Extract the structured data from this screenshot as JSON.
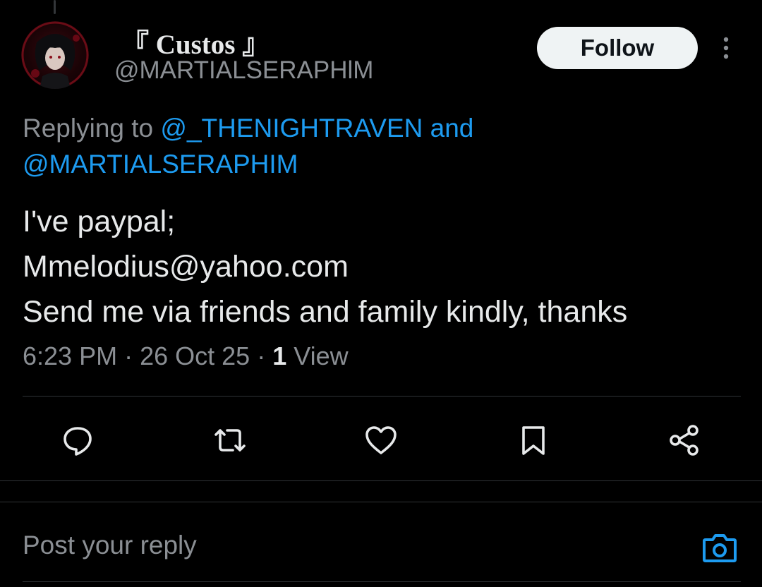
{
  "tweet": {
    "author": {
      "display_name": "『 Custos 』",
      "handle": "@MARTIALSERAPHlM",
      "avatar_icon": "avatar-red-portrait"
    },
    "follow_label": "Follow",
    "replying_to": {
      "prefix": "Replying to",
      "mention_1": "@_THENIGHTRAVEN",
      "conjunction": "and",
      "mention_2": "@MARTIALSERAPHIM"
    },
    "body_lines": [
      "I've paypal;",
      "Mmelodius@yahoo.com",
      "Send me via friends and family kindly, thanks"
    ],
    "meta": {
      "time": "6:23 PM",
      "date": "26 Oct 25",
      "view_count": "1",
      "view_label": "View"
    },
    "actions": [
      "reply-icon",
      "retweet-icon",
      "like-icon",
      "bookmark-icon",
      "share-icon"
    ]
  },
  "composer": {
    "placeholder": "Post your reply",
    "camera_icon": "camera-icon"
  },
  "colors": {
    "background": "#000000",
    "text_primary": "#e7e9ea",
    "text_secondary": "#8b8f94",
    "accent": "#1d9bf0",
    "divider": "#2f3336",
    "button_bg": "#eff3f4"
  }
}
